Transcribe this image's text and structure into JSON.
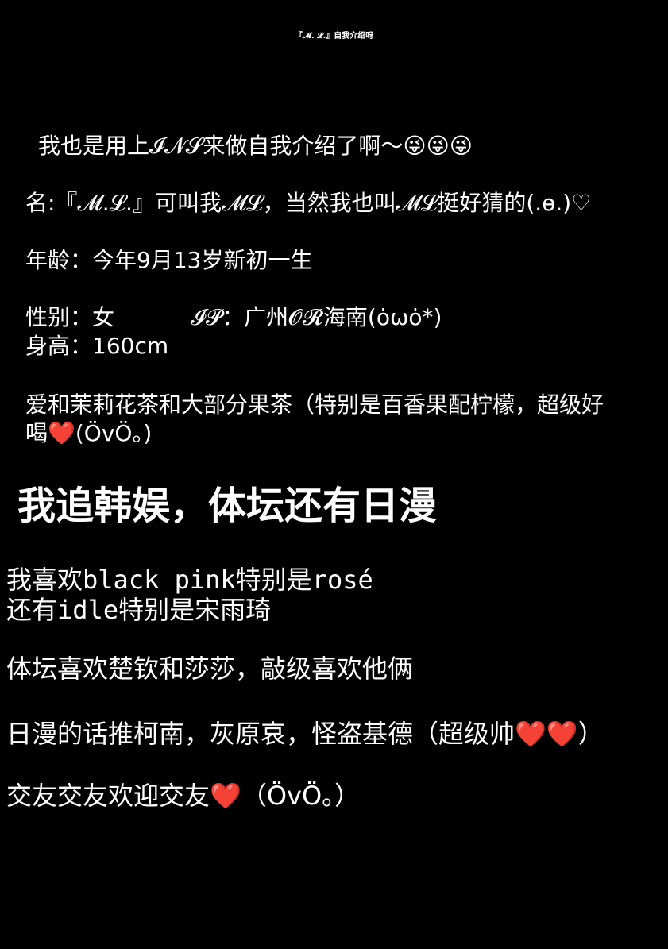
{
  "header": {
    "title": "『𝓜. 𝓛.』自我介绍呀"
  },
  "intro": {
    "text": "我也是用上𝓘𝓝𝓢来做自我介绍了啊～😜😜😜"
  },
  "profile": {
    "name": "名:『𝓜.𝓛.』可叫我𝓜𝓛，当然我也叫𝓜𝓛挺好猜的(.ө.)♡",
    "age": "年龄：今年9月13岁新初一生",
    "gender": "性别：女",
    "ip": "𝓘𝓟：广州𝓞𝓡海南(ȯωȯ*)",
    "height": "身高：160cm",
    "tea_line1": "爱和茉莉花茶和大部分果茶（特别是百香果配柠檬，超级好",
    "tea_line2": "喝❤️(ÖvÖ。)"
  },
  "section": {
    "heading": "我追韩娱，体坛还有日漫"
  },
  "interests": {
    "kpop_prefix": "我喜欢",
    "kpop_group1": "black pink",
    "kpop_mid": "特别是",
    "kpop_member1": "rosé",
    "kpop2_prefix": "还有",
    "kpop_group2": "idle",
    "kpop2_mid": "特别是宋雨琦",
    "sports": "体坛喜欢楚钦和莎莎，敲级喜欢他俩",
    "anime": "日漫的话推柯南，灰原哀，怪盗基德（超级帅❤️❤️）",
    "friends": "交友交友欢迎交友❤️（ÖvÖ。）"
  }
}
